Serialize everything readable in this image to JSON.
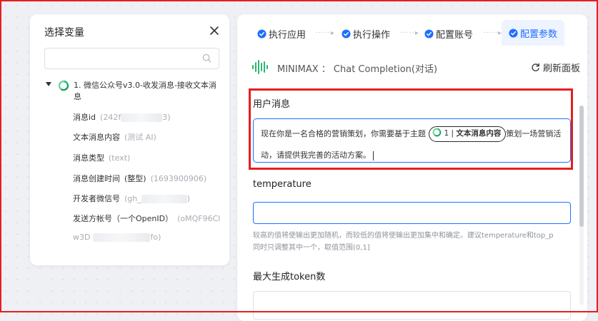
{
  "variable_panel": {
    "title": "选择变量",
    "search_placeholder": "",
    "root": "1. 微信公众号v3.0-收发消息-接收文本消息",
    "items": [
      {
        "name": "消息id",
        "hint_start": "(242f",
        "hint_end": "3)"
      },
      {
        "name": "文本消息内容",
        "hint": "(测试 AI)"
      },
      {
        "name": "消息类型",
        "hint": "(text)"
      },
      {
        "name": "消息创建时间",
        "tag": "(整型)",
        "hint": "(1693900906)"
      },
      {
        "name": "开发者微信号",
        "hint_start": "(gh_",
        "hint_end": ")"
      },
      {
        "name": "发送方帐号（一个OpenID）",
        "hint": "(oMQF96Cl"
      },
      {
        "name": "w3D",
        "hint_end": "fo)"
      }
    ]
  },
  "steps": [
    {
      "label": "执行应用"
    },
    {
      "label": "执行操作"
    },
    {
      "label": "配置账号"
    },
    {
      "label": "配置参数"
    }
  ],
  "step_arrow": "·····▸",
  "model": {
    "provider": "MINIMAX",
    "separator": "：",
    "name": "Chat Completion(对话)",
    "refresh_label": "刷新面板"
  },
  "user_message": {
    "label": "用户消息",
    "text_before": "现在你是一名合格的营销策划，你需要基于主题",
    "chip_index": "1 |",
    "chip_label": "文本消息内容",
    "text_after": "策划一场营销活",
    "text_line2": "动，请提供我完善的活动方案。"
  },
  "temperature": {
    "label": "temperature",
    "value": "",
    "hint_line1": "较高的值将使输出更加随机，而较低的值将使输出更加集中和确定。建议temperature和top_p",
    "hint_line2": "同时只调整其中一个，取值范围(0,1]"
  },
  "max_tokens": {
    "label": "最大生成token数",
    "value": ""
  },
  "colors": {
    "accent": "#1e6fff",
    "highlight": "#e41f1f",
    "brand_green": "#2bb673"
  }
}
